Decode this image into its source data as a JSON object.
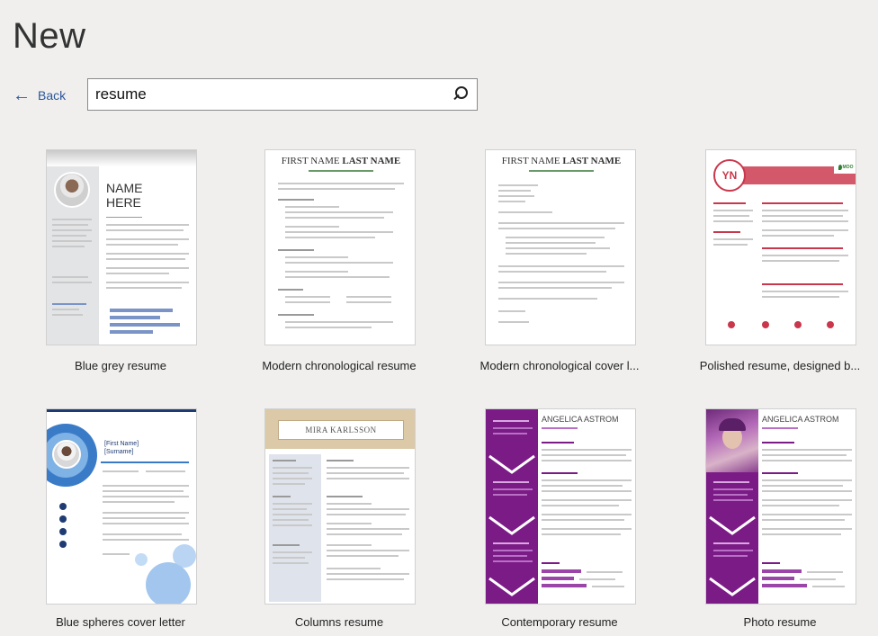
{
  "header": {
    "title": "New"
  },
  "nav": {
    "back_label": "Back"
  },
  "search": {
    "value": "resume"
  },
  "templates": [
    {
      "caption": "Blue grey resume",
      "preview": {
        "name": "NAME HERE"
      }
    },
    {
      "caption": "Modern chronological resume",
      "preview": {
        "first": "FIRST NAME",
        "last": "LAST NAME"
      }
    },
    {
      "caption": "Modern chronological cover l...",
      "preview": {
        "first": "FIRST NAME",
        "last": "LAST NAME"
      }
    },
    {
      "caption": "Polished resume, designed b...",
      "preview": {
        "initials": "YN",
        "brand": "MOO"
      }
    },
    {
      "caption": "Blue spheres cover letter",
      "preview": {
        "name": "[First Name] [Surname]"
      }
    },
    {
      "caption": "Columns resume",
      "preview": {
        "name": "MIRA KARLSSON"
      }
    },
    {
      "caption": "Contemporary resume",
      "preview": {
        "name": "ANGELICA ASTROM"
      }
    },
    {
      "caption": "Photo resume",
      "preview": {
        "name": "ANGELICA ASTROM"
      }
    }
  ],
  "colors": {
    "accent": "#2b579a",
    "purple": "#7b1b86",
    "red": "#c9374c",
    "blue": "#3a7bc8"
  }
}
